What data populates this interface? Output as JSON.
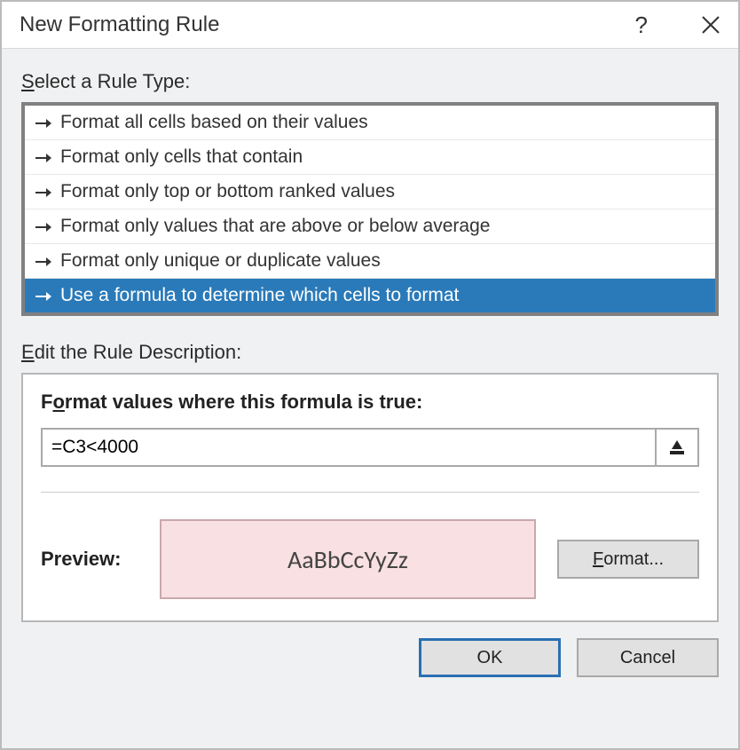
{
  "titlebar": {
    "title": "New Formatting Rule",
    "help_label": "?",
    "close_label": "✕"
  },
  "labels": {
    "select_rule_type_prefix": "S",
    "select_rule_type_rest": "elect a Rule Type:",
    "edit_desc_prefix": "E",
    "edit_desc_rest": "dit the Rule Description:",
    "format_values_pre": "F",
    "format_values_u": "o",
    "format_values_post": "rmat values where this formula is true:",
    "preview": "Preview:",
    "format_btn_u": "F",
    "format_btn_rest": "ormat...",
    "ok": "OK",
    "cancel": "Cancel"
  },
  "rule_types": [
    {
      "label": "Format all cells based on their values",
      "selected": false
    },
    {
      "label": "Format only cells that contain",
      "selected": false
    },
    {
      "label": "Format only top or bottom ranked values",
      "selected": false
    },
    {
      "label": "Format only values that are above or below average",
      "selected": false
    },
    {
      "label": "Format only unique or duplicate values",
      "selected": false
    },
    {
      "label": "Use a formula to determine which cells to format",
      "selected": true
    }
  ],
  "formula": {
    "value": "=C3<4000"
  },
  "preview": {
    "sample_text": "AaBbCcYyZz",
    "fill_color": "#f9e0e2",
    "border_color": "#c9a9ac"
  }
}
